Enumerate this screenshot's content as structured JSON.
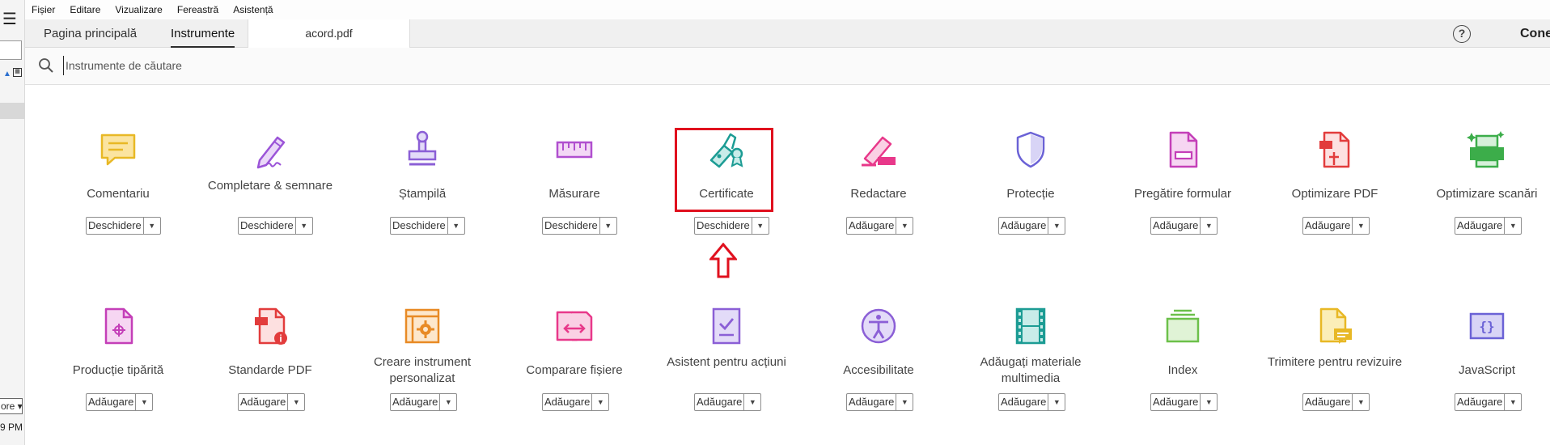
{
  "left_strip": {
    "menu_glyph": "☰",
    "select_value": "ore",
    "time_text": "9 PM"
  },
  "menubar": {
    "items": [
      "Fișier",
      "Editare",
      "Vizualizare",
      "Fereastră",
      "Asistență"
    ]
  },
  "tabs": {
    "home": "Pagina principală",
    "tools": "Instrumente",
    "document": "acord.pdf"
  },
  "header_right": {
    "help_glyph": "?",
    "connect": "Conectar"
  },
  "search": {
    "placeholder": "Instrumente de căutare"
  },
  "tools_row1": [
    {
      "label": "Comentariu",
      "button": "Deschidere",
      "icon": "comment-icon",
      "color": "#e8b825"
    },
    {
      "label": "Completare & semnare",
      "button": "Deschidere",
      "icon": "fill-sign-icon",
      "color": "#9b54d8"
    },
    {
      "label": "Ștampilă",
      "button": "Deschidere",
      "icon": "stamp-icon",
      "color": "#8b5fd6"
    },
    {
      "label": "Măsurare",
      "button": "Deschidere",
      "icon": "ruler-icon",
      "color": "#b04fcf"
    },
    {
      "label": "Certificate",
      "button": "Deschidere",
      "icon": "certificate-pen-icon",
      "color": "#1c9c94"
    },
    {
      "label": "Redactare",
      "button": "Adăugare",
      "icon": "redact-icon",
      "color": "#e8388a"
    },
    {
      "label": "Protecție",
      "button": "Adăugare",
      "icon": "shield-icon",
      "color": "#6b62d6"
    },
    {
      "label": "Pregătire formular",
      "button": "Adăugare",
      "icon": "form-icon",
      "color": "#c43fb8"
    },
    {
      "label": "Optimizare PDF",
      "button": "Adăugare",
      "icon": "optimize-pdf-icon",
      "color": "#e23c3c"
    },
    {
      "label": "Optimizare scanări",
      "button": "Adăugare",
      "icon": "scanner-icon",
      "color": "#3cad4a"
    }
  ],
  "tools_row2": [
    {
      "label": "Producție tipărită",
      "button": "Adăugare",
      "icon": "print-production-icon",
      "color": "#c43fb8"
    },
    {
      "label": "Standarde PDF",
      "button": "Adăugare",
      "icon": "pdf-standards-icon",
      "color": "#e23c3c"
    },
    {
      "label": "Creare instrument personalizat",
      "button": "Adăugare",
      "icon": "custom-tool-icon",
      "color": "#e88a25"
    },
    {
      "label": "Comparare fișiere",
      "button": "Adăugare",
      "icon": "compare-files-icon",
      "color": "#e8388a"
    },
    {
      "label": "Asistent pentru acțiuni",
      "button": "Adăugare",
      "icon": "action-wizard-icon",
      "color": "#8b5fd6"
    },
    {
      "label": "Accesibilitate",
      "button": "Adăugare",
      "icon": "accessibility-icon",
      "color": "#8b5fd6"
    },
    {
      "label": "Adăugați materiale multimedia",
      "button": "Adăugare",
      "icon": "film-icon",
      "color": "#1c9c94"
    },
    {
      "label": "Index",
      "button": "Adăugare",
      "icon": "index-icon",
      "color": "#6cc04a"
    },
    {
      "label": "Trimitere pentru revizuire",
      "button": "Adăugare",
      "icon": "send-review-icon",
      "color": "#e8b825"
    },
    {
      "label": "JavaScript",
      "button": "Adăugare",
      "icon": "javascript-icon",
      "color": "#6b62d6"
    }
  ],
  "annotation": {
    "highlight_color": "#e0101e"
  }
}
